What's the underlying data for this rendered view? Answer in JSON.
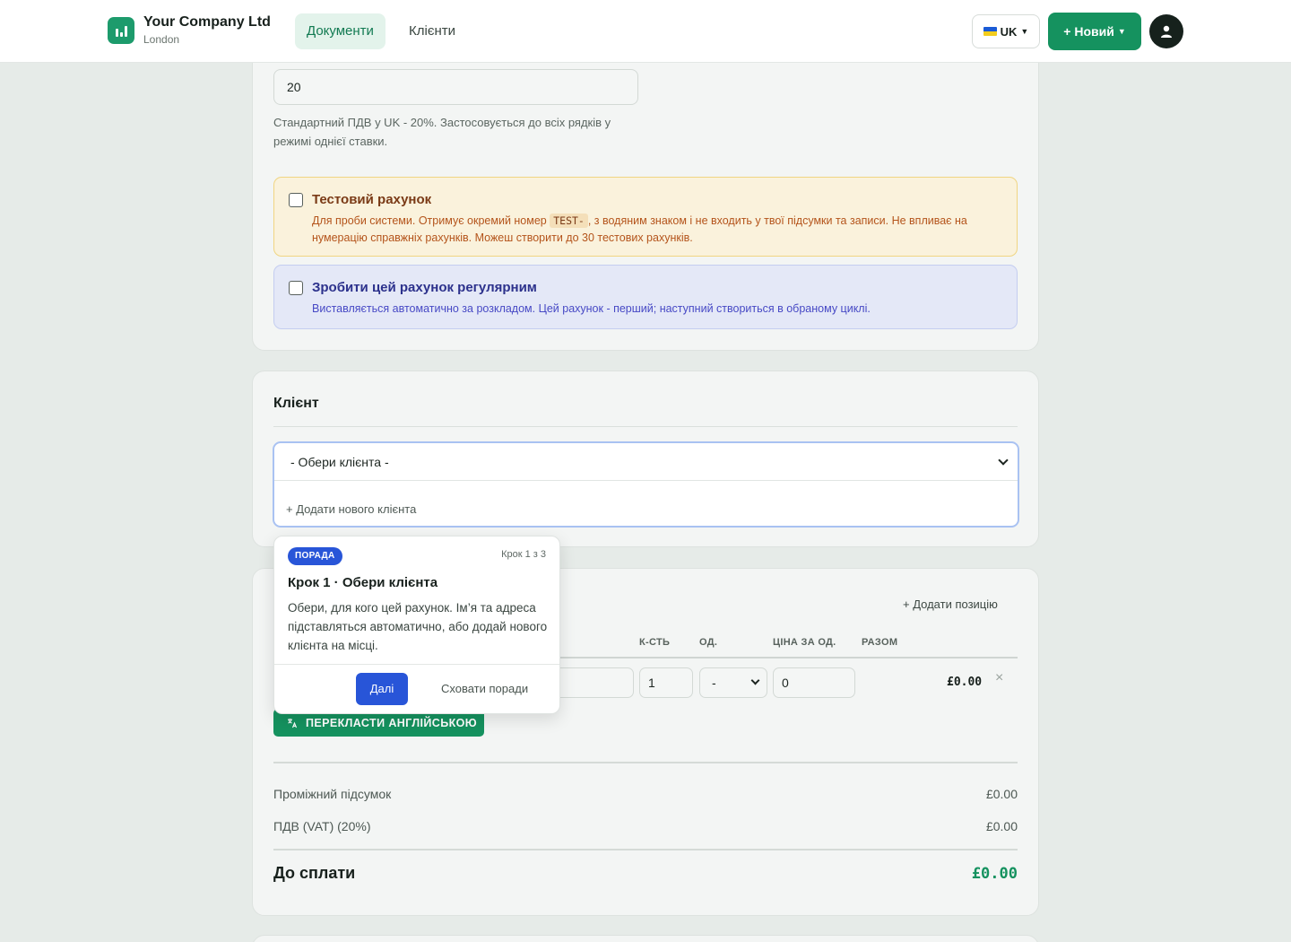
{
  "header": {
    "company_name": "Your Company Ltd",
    "company_city": "London",
    "tabs": [
      "Документи",
      "Клієнти"
    ],
    "active_tab": "Документи",
    "language": "UK",
    "new_button": "+ Новий",
    "brand_color": "#15925f"
  },
  "vat": {
    "value": "20",
    "hint": "Стандартний ПДВ у UK - 20%. Застосовується до всіх рядків у режимі однієї ставки."
  },
  "test_invoice": {
    "title": "Тестовий рахунок",
    "desc_before": "Для проби системи. Отримує окремий номер ",
    "code": "TEST-",
    "desc_after": ", з водяним знаком і не входить у твої підсумки та записи. Не впливає на нумерацію справжніх рахунків. Можеш створити до 30 тестових рахунків.",
    "checked": false
  },
  "recurring": {
    "title": "Зробити цей рахунок регулярним",
    "desc": "Виставляється автоматично за розкладом. Цей рахунок - перший; наступний створиться в обраному циклі.",
    "checked": false
  },
  "client": {
    "section_title": "Клієнт",
    "select_value": "- Обери клієнта -",
    "add_new": "+ Додати нового клієнта"
  },
  "items": {
    "add_position": "+ Додати позицію",
    "columns": [
      "К-СТЬ",
      "ОД.",
      "ЦІНА ЗА ОД.",
      "РАЗОМ"
    ],
    "row": {
      "qty": "1",
      "unit": "-",
      "price": "0",
      "total": "£0.00",
      "remove": "×"
    },
    "translate_button": "ПЕРЕКЛАСТИ АНГЛІЙСЬКОЮ"
  },
  "totals": {
    "subtotal_label": "Проміжний підсумок",
    "subtotal_value": "£0.00",
    "vat_label": "ПДВ (VAT) (20%)",
    "vat_value": "£0.00",
    "due_label": "До сплати",
    "due_value": "£0.00"
  },
  "tip": {
    "badge": "ПОРАДА",
    "step": "Крок 1 з 3",
    "title": "Крок 1 · Обери клієнта",
    "text": "Обери, для кого цей рахунок. Ім’я та адреса підставляться автоматично, або додай нового клієнта на місці.",
    "next": "Далі",
    "hide": "Сховати поради"
  }
}
